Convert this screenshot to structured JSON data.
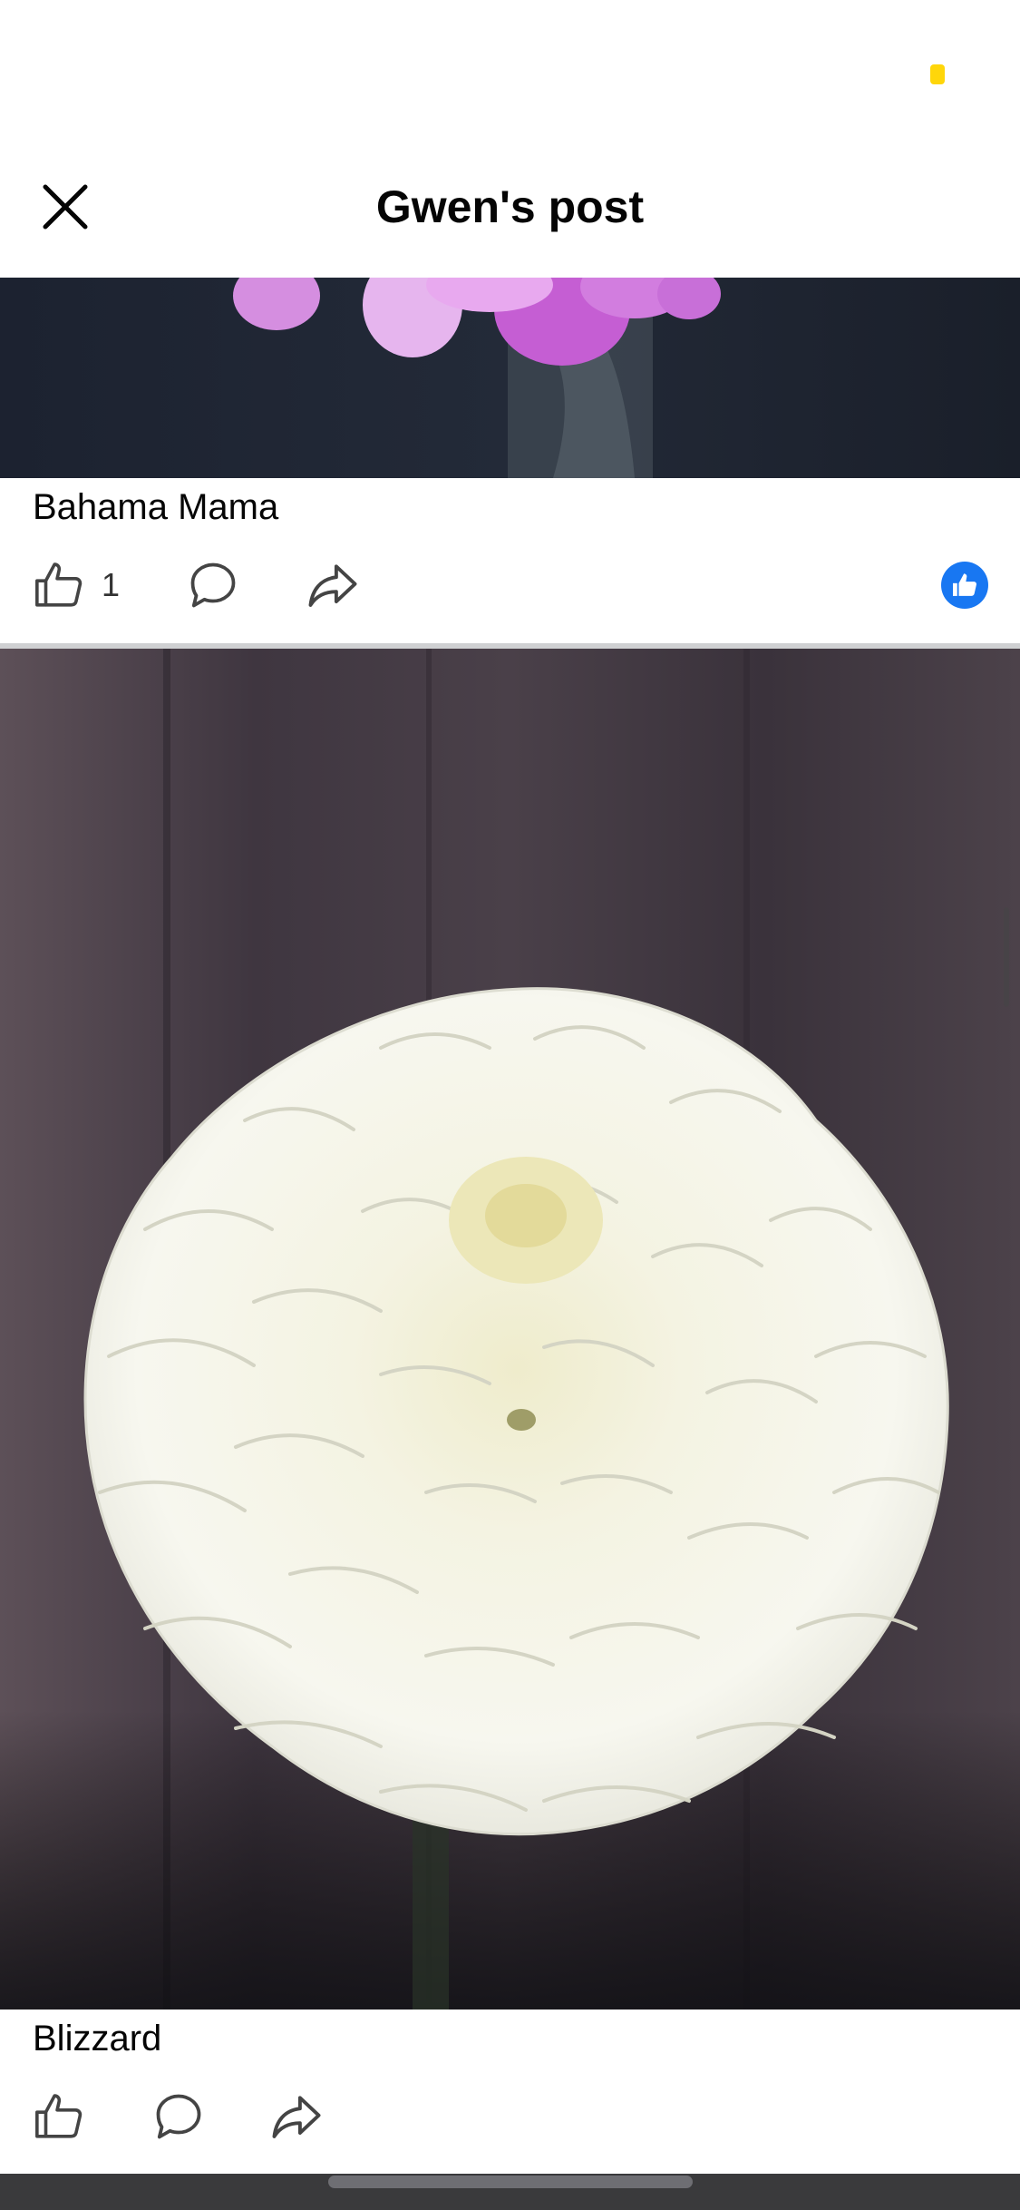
{
  "header": {
    "title": "Gwen's post"
  },
  "posts": [
    {
      "caption": "Bahama Mama",
      "like_count": "1"
    },
    {
      "caption": "Blizzard",
      "like_count": ""
    }
  ],
  "colors": {
    "brand_blue": "#1877F2",
    "status_dot": "#FFD60A"
  },
  "icons": [
    "close-icon",
    "like-icon",
    "comment-icon",
    "share-icon",
    "like-reaction-icon"
  ]
}
